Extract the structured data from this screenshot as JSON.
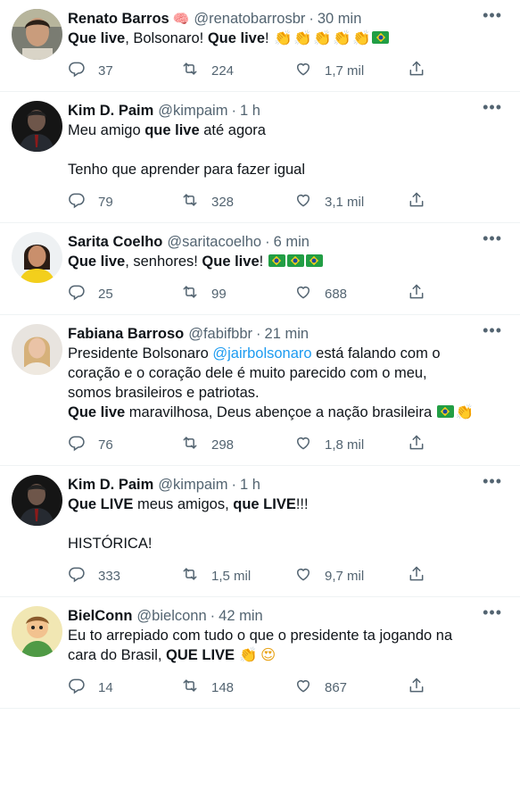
{
  "colors": {
    "text": "#0f1419",
    "secondary": "#536471",
    "link": "#1d9bf0",
    "divider": "#eff3f4"
  },
  "tweets": [
    {
      "name": "Renato Barros",
      "badge": "🧠",
      "handle": "@renatobarrosbr",
      "time": "30 min",
      "lines": [
        [
          {
            "t": "Que live",
            "b": true
          },
          {
            "t": ", Bolsonaro! "
          },
          {
            "t": "Que live",
            "b": true
          },
          {
            "t": "! "
          },
          {
            "e": "clap"
          },
          {
            "e": "clap"
          },
          {
            "e": "clap"
          },
          {
            "e": "clap"
          },
          {
            "e": "clap"
          },
          {
            "e": "flag"
          }
        ]
      ],
      "reply": "37",
      "retweet": "224",
      "like": "1,7 mil",
      "avatar": "person-dark-hair"
    },
    {
      "name": "Kim D. Paim",
      "handle": "@kimpaim",
      "time": "1 h",
      "lines": [
        [
          {
            "t": "Meu amigo "
          },
          {
            "t": "que live",
            "b": true
          },
          {
            "t": " até agora"
          }
        ],
        [],
        [
          {
            "t": "Tenho que aprender para fazer igual"
          }
        ]
      ],
      "reply": "79",
      "retweet": "328",
      "like": "3,1 mil",
      "avatar": "person-suit"
    },
    {
      "name": "Sarita Coelho",
      "handle": "@saritacoelho",
      "time": "6 min",
      "lines": [
        [
          {
            "t": "Que live",
            "b": true
          },
          {
            "t": ", senhores! "
          },
          {
            "t": "Que live",
            "b": true
          },
          {
            "t": "! "
          },
          {
            "e": "flag"
          },
          {
            "e": "flag"
          },
          {
            "e": "flag"
          }
        ]
      ],
      "reply": "25",
      "retweet": "99",
      "like": "688",
      "avatar": "person-yellow"
    },
    {
      "name": "Fabiana Barroso",
      "handle": "@fabifbbr",
      "time": "21 min",
      "lines": [
        [
          {
            "t": "Presidente Bolsonaro "
          },
          {
            "t": "@jairbolsonaro",
            "m": true
          },
          {
            "t": " está falando com o"
          }
        ],
        [
          {
            "t": "coração e o coração dele é muito parecido com o meu,"
          }
        ],
        [
          {
            "t": "somos brasileiros e patriotas."
          }
        ],
        [
          {
            "t": "Que live",
            "b": true
          },
          {
            "t": " maravilhosa, Deus abençoe a nação brasileira "
          },
          {
            "e": "flag"
          },
          {
            "e": "clap-light"
          }
        ]
      ],
      "reply": "76",
      "retweet": "298",
      "like": "1,8 mil",
      "avatar": "person-blonde"
    },
    {
      "name": "Kim D. Paim",
      "handle": "@kimpaim",
      "time": "1 h",
      "lines": [
        [
          {
            "t": "Que LIVE",
            "b": true
          },
          {
            "t": " meus amigos, "
          },
          {
            "t": "que LIVE",
            "b": true
          },
          {
            "t": "!!!"
          }
        ],
        [],
        [
          {
            "t": "HISTÓRICA!"
          }
        ]
      ],
      "reply": "333",
      "retweet": "1,5 mil",
      "like": "9,7 mil",
      "avatar": "person-suit"
    },
    {
      "name": "BielConn",
      "handle": "@bielconn",
      "time": "42 min",
      "lines": [
        [
          {
            "t": "Eu to arrepiado com tudo o que o presidente ta jogando na"
          }
        ],
        [
          {
            "t": "cara do Brasil, "
          },
          {
            "t": "QUE LIVE",
            "b": true
          },
          {
            "t": " "
          },
          {
            "e": "clap"
          },
          {
            "e": "heart-eyes"
          }
        ]
      ],
      "reply": "14",
      "retweet": "148",
      "like": "867",
      "avatar": "cartoon-character"
    }
  ]
}
